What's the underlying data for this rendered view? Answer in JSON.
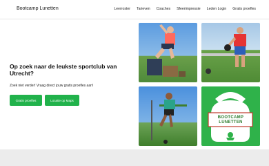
{
  "header": {
    "brand": "Bootcamp Lunetten",
    "nav": [
      "Leerroster",
      "Tarieven",
      "Coaches",
      "Sfeerimpressie",
      "Leden Login",
      "Gratis proefles"
    ]
  },
  "hero": {
    "headline": "Op zoek naar de leukste sportclub van Utrecht?",
    "subtext": "Zoek niet verder! Vraag direct jouw gratis proefles aan!",
    "buttons": {
      "prices": "Gratis proefles",
      "location": "Locatie op Maps"
    }
  },
  "gallery": {
    "logo_text_line1": "BOOTCAMP",
    "logo_text_line2": "LUNETTEN"
  },
  "colors": {
    "accent": "#21b24b",
    "logo_green": "#2fb24a"
  }
}
